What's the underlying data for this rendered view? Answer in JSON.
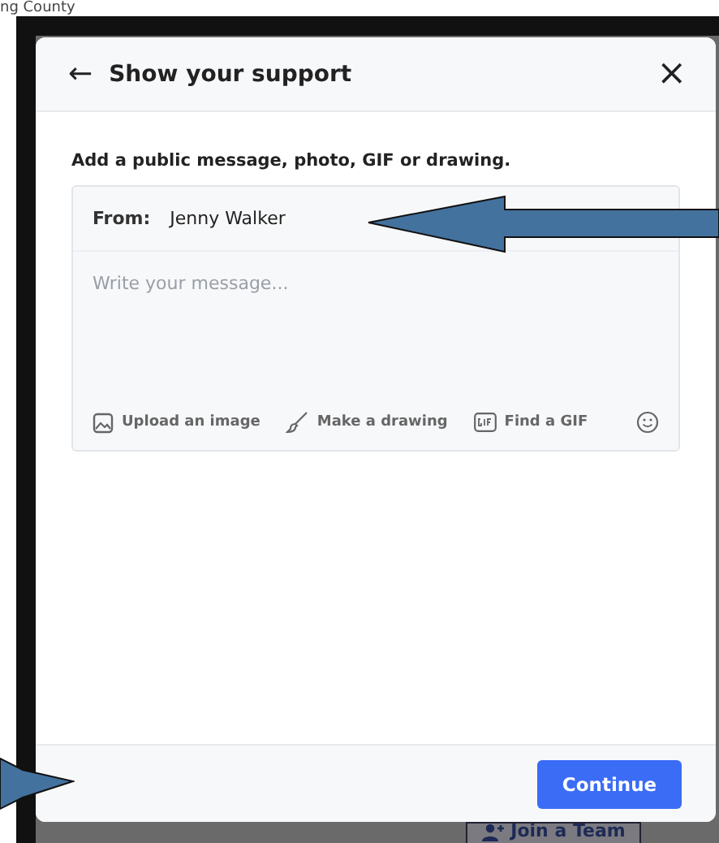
{
  "background_page": {
    "heading": "ng County",
    "join_button": "Join a Team"
  },
  "dialog": {
    "back": "←",
    "title": "Show your support",
    "close": "×",
    "instruction": "Add a public message, photo, GIF or drawing.",
    "from_label": "From:",
    "from_name": "Jenny Walker",
    "message": {
      "placeholder": "Write your message..."
    },
    "tools": [
      {
        "kind": "image",
        "label": "Upload an image"
      },
      {
        "kind": "drawing",
        "label": "Make a drawing"
      },
      {
        "kind": "gif",
        "label": "Find a GIF"
      }
    ],
    "continue_button": "Continue"
  }
}
